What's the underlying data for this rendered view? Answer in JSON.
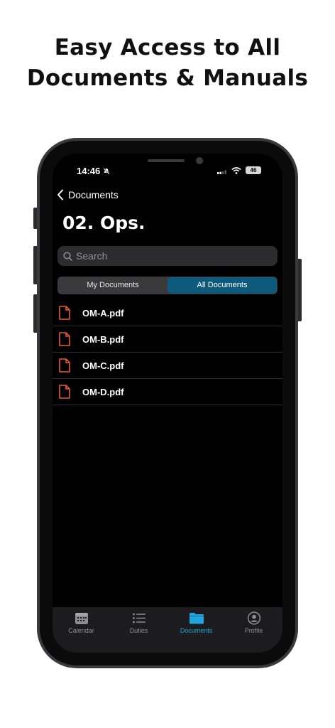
{
  "headline": {
    "line1": "Easy Access to All",
    "line2": "Documents & Manuals"
  },
  "status_bar": {
    "time": "14:46",
    "battery_level": "46"
  },
  "nav": {
    "back_label": "Documents",
    "title": "02. Ops."
  },
  "search": {
    "placeholder": "Search",
    "value": ""
  },
  "segments": [
    {
      "label": "My Documents",
      "selected": false
    },
    {
      "label": "All Documents",
      "selected": true
    }
  ],
  "documents": [
    {
      "name": "OM-A.pdf",
      "icon": "pdf-file-icon"
    },
    {
      "name": "OM-B.pdf",
      "icon": "pdf-file-icon"
    },
    {
      "name": "OM-C.pdf",
      "icon": "pdf-file-icon"
    },
    {
      "name": "OM-D.pdf",
      "icon": "pdf-file-icon"
    }
  ],
  "tab_bar": [
    {
      "label": "Calendar",
      "icon": "calendar-icon",
      "active": false
    },
    {
      "label": "Duties",
      "icon": "list-icon",
      "active": false
    },
    {
      "label": "Documents",
      "icon": "folder-icon",
      "active": true
    },
    {
      "label": "Profile",
      "icon": "profile-icon",
      "active": false
    }
  ],
  "colors": {
    "accent": "#1ea7de",
    "segment_active": "#0e5a7c",
    "pdf_icon": "#e8573a",
    "background": "#000000"
  }
}
